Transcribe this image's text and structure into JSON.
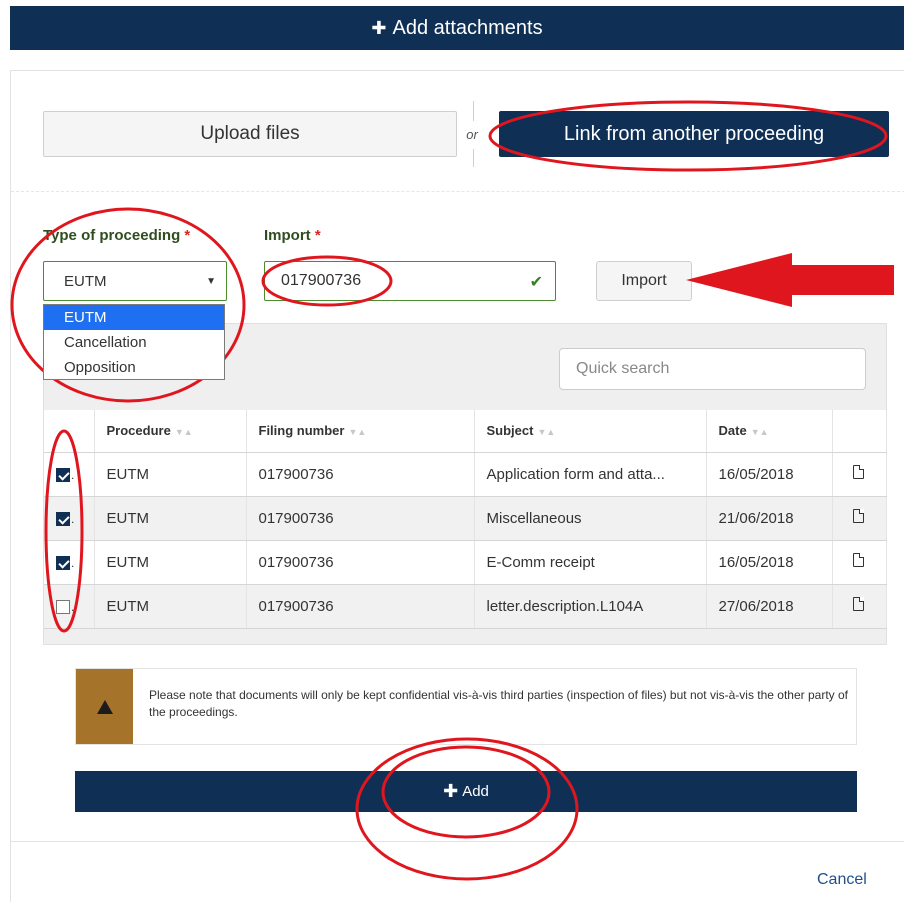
{
  "header": {
    "title": "Add attachments"
  },
  "source_buttons": {
    "upload": "Upload files",
    "or": "or",
    "link": "Link from another proceeding"
  },
  "form": {
    "type_label": "Type of proceeding",
    "import_label": "Import",
    "required_mark": "*",
    "selected_type": "EUTM",
    "type_options": [
      "EUTM",
      "Cancellation",
      "Opposition"
    ],
    "import_value": "017900736",
    "import_button": "Import"
  },
  "search": {
    "placeholder": "Quick search"
  },
  "table": {
    "columns": [
      "Procedure",
      "Filing number",
      "Subject",
      "Date"
    ],
    "rows": [
      {
        "checked": true,
        "procedure": "EUTM",
        "filing": "017900736",
        "subject": "Application form and atta...",
        "date": "16/05/2018"
      },
      {
        "checked": true,
        "procedure": "EUTM",
        "filing": "017900736",
        "subject": "Miscellaneous",
        "date": "21/06/2018"
      },
      {
        "checked": true,
        "procedure": "EUTM",
        "filing": "017900736",
        "subject": "E-Comm receipt",
        "date": "16/05/2018"
      },
      {
        "checked": false,
        "procedure": "EUTM",
        "filing": "017900736",
        "subject": "letter.description.L104A",
        "date": "27/06/2018"
      }
    ]
  },
  "notice": {
    "text": "Please note that documents will only be kept confidential vis-à-vis third parties (inspection of files) but not vis-à-vis the other party of the proceedings."
  },
  "actions": {
    "add": "Add",
    "cancel": "Cancel"
  },
  "colors": {
    "navy": "#0f2f55",
    "annotation_red": "#e0161e",
    "link_blue": "#1f4f8a",
    "warning_brown": "#a5742a"
  }
}
